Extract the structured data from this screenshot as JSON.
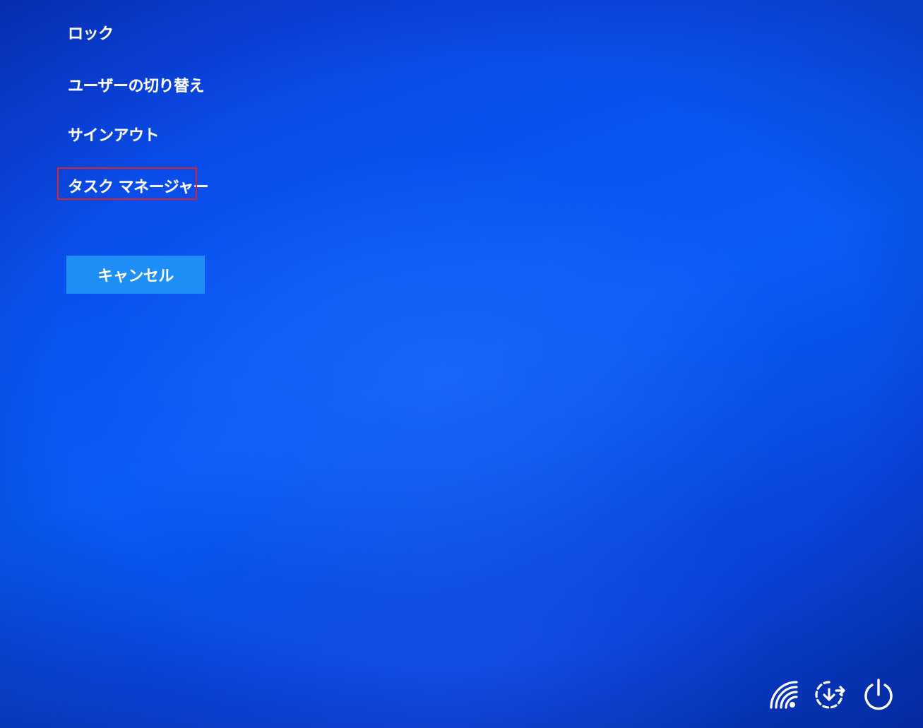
{
  "menu": {
    "items": [
      {
        "id": "lock",
        "label": "ロック"
      },
      {
        "id": "switch-user",
        "label": "ユーザーの切り替え"
      },
      {
        "id": "sign-out",
        "label": "サインアウト"
      },
      {
        "id": "task-manager",
        "label": "タスク マネージャー"
      }
    ],
    "highlighted_item": "task-manager",
    "highlight_color": "#e0201c"
  },
  "cancel": {
    "label": "キャンセル",
    "color": "#1f8ff7"
  },
  "system_icons": [
    {
      "id": "network",
      "icon": "network-wifi-icon"
    },
    {
      "id": "ease-of-access",
      "icon": "ease-of-access-icon"
    },
    {
      "id": "power",
      "icon": "power-icon"
    }
  ],
  "colors": {
    "background": "#0a52f0",
    "text": "#ffffff"
  }
}
